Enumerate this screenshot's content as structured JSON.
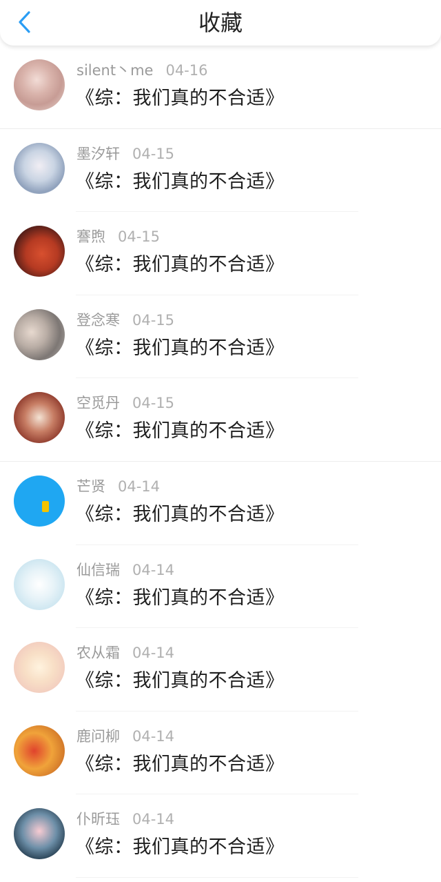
{
  "header": {
    "title": "收藏",
    "back_icon": "chevron-left-icon",
    "accent": "#2a9df4"
  },
  "items": [
    {
      "user": "silent丶me",
      "date": "04-16",
      "title": "《综：我们真的不合适》"
    },
    {
      "user": "墨汐轩",
      "date": "04-15",
      "title": "《综：我们真的不合适》"
    },
    {
      "user": "謇煦",
      "date": "04-15",
      "title": "《综：我们真的不合适》"
    },
    {
      "user": "登念寒",
      "date": "04-15",
      "title": "《综：我们真的不合适》"
    },
    {
      "user": "空觅丹",
      "date": "04-15",
      "title": "《综：我们真的不合适》"
    },
    {
      "user": "芒贤",
      "date": "04-14",
      "title": "《综：我们真的不合适》"
    },
    {
      "user": "仙信瑞",
      "date": "04-14",
      "title": "《综：我们真的不合适》"
    },
    {
      "user": "农从霜",
      "date": "04-14",
      "title": "《综：我们真的不合适》"
    },
    {
      "user": "鹿问柳",
      "date": "04-14",
      "title": "《综：我们真的不合适》"
    },
    {
      "user": "仆昕珏",
      "date": "04-14",
      "title": "《综：我们真的不合适》"
    }
  ]
}
